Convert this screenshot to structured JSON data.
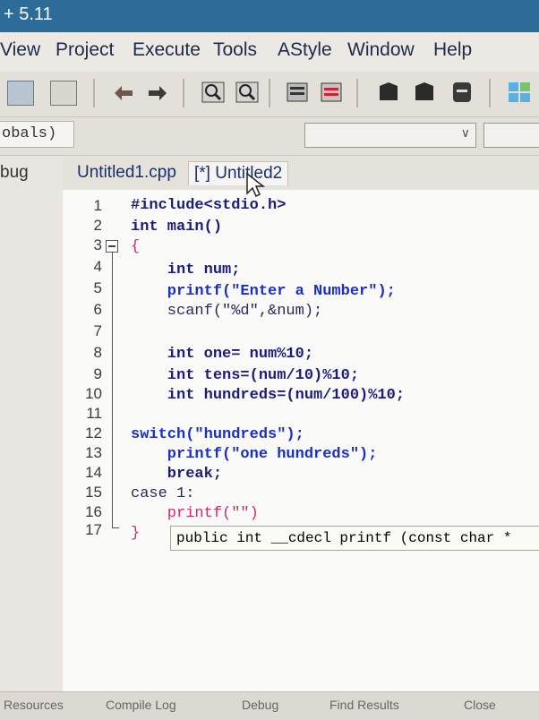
{
  "window": {
    "title": "+ 5.11"
  },
  "menu": [
    "View",
    "Project",
    "Execute",
    "Tools",
    "AStyle",
    "Window",
    "Help"
  ],
  "toolbar_icons": [
    "project-icon",
    "print-icon",
    "undo-icon",
    "redo-icon",
    "find-icon",
    "replace-icon",
    "compile-icon",
    "run-icon",
    "save-icon",
    "saveall-icon",
    "close-icon",
    "grid-icon"
  ],
  "combobar": {
    "globals_label": "obals)"
  },
  "sidebar": {
    "tab_label": "bug"
  },
  "tabs": [
    {
      "label": "Untitled1.cpp",
      "active": false
    },
    {
      "label": "[*] Untitled2",
      "active": true
    }
  ],
  "code": {
    "line_numbers": [
      "1",
      "2",
      "3",
      "4",
      "5",
      "6",
      "7",
      "8",
      "9",
      "10",
      "11",
      "12",
      "13",
      "14",
      "15",
      "16",
      "17"
    ],
    "lines": [
      "#include<stdio.h>",
      "int main()",
      "{",
      "    int num;",
      "    printf(\"Enter a Number\");",
      "    scanf(\"%d\",&num);",
      "",
      "    int one= num%10;",
      "    int tens=(num/10)%10;",
      "    int hundreds=(num/100)%10;",
      "",
      "switch(\"hundreds\");",
      "    printf(\"one hundreds\");",
      "    break;",
      "case 1:",
      "    printf(\"\")",
      "}"
    ]
  },
  "tooltip": {
    "text": "public int __cdecl printf (const char *"
  },
  "bottom_tabs": [
    "Resources",
    "Compile Log",
    "Debug",
    "Find Results",
    "Close"
  ]
}
